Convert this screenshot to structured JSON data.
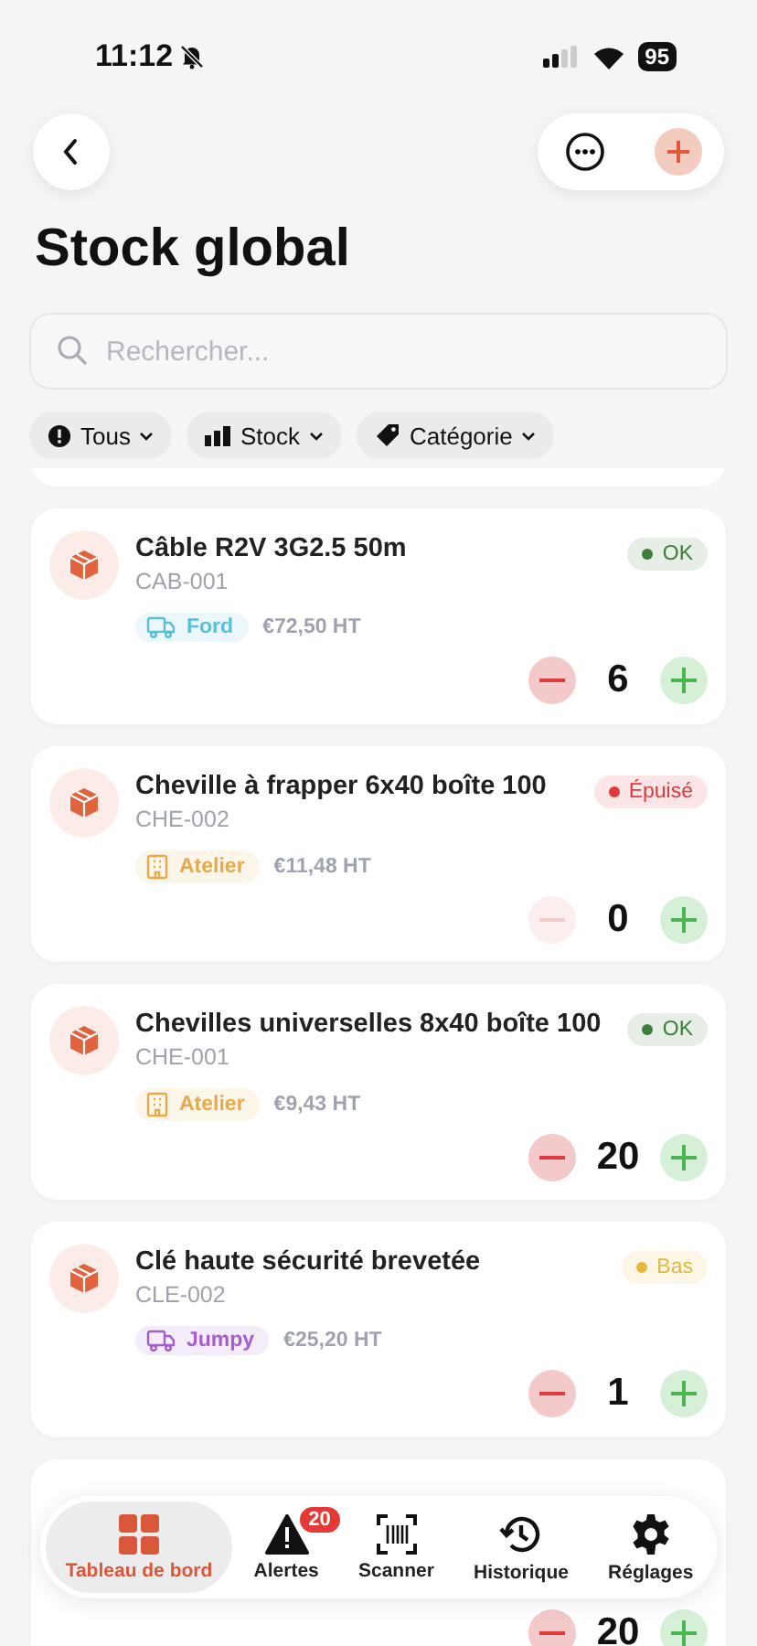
{
  "status_bar": {
    "time": "11:12",
    "battery": "95"
  },
  "title": "Stock global",
  "search": {
    "placeholder": "Rechercher..."
  },
  "filters": [
    {
      "label": "Tous"
    },
    {
      "label": "Stock"
    },
    {
      "label": "Catégorie"
    }
  ],
  "items": [
    {
      "name": "Câble R2V 3G2.5 50m",
      "code": "CAB-001",
      "location": {
        "label": "Ford",
        "kind": "vehicle",
        "color": "#5bbfd6"
      },
      "price": "€72,50 HT",
      "status": {
        "label": "OK",
        "color": "#3f7d3c"
      },
      "quantity": "6",
      "minus_disabled": false
    },
    {
      "name": "Cheville à frapper 6x40 boîte 100",
      "code": "CHE-002",
      "location": {
        "label": "Atelier",
        "kind": "workshop",
        "color": "#e8a94a"
      },
      "price": "€11,48 HT",
      "status": {
        "label": "Épuisé",
        "color": "#e0393e"
      },
      "quantity": "0",
      "minus_disabled": true
    },
    {
      "name": "Chevilles universelles 8x40 boîte 100",
      "code": "CHE-001",
      "location": {
        "label": "Atelier",
        "kind": "workshop",
        "color": "#e8a94a"
      },
      "price": "€9,43 HT",
      "status": {
        "label": "OK",
        "color": "#3f7d3c"
      },
      "quantity": "20",
      "minus_disabled": false
    },
    {
      "name": "Clé haute sécurité brevetée",
      "code": "CLE-002",
      "location": {
        "label": "Jumpy",
        "kind": "vehicle",
        "color": "#a35fcf"
      },
      "price": "€25,20 HT",
      "status": {
        "label": "Bas",
        "color": "#e6b83a"
      },
      "quantity": "1",
      "minus_disabled": false
    },
    {
      "quantity": "20",
      "minus_disabled": false
    }
  ],
  "tabs": [
    {
      "label": "Tableau de bord",
      "selected": true
    },
    {
      "label": "Alertes",
      "selected": false,
      "badge": "20"
    },
    {
      "label": "Scanner",
      "selected": false
    },
    {
      "label": "Historique",
      "selected": false
    },
    {
      "label": "Réglages",
      "selected": false
    }
  ]
}
